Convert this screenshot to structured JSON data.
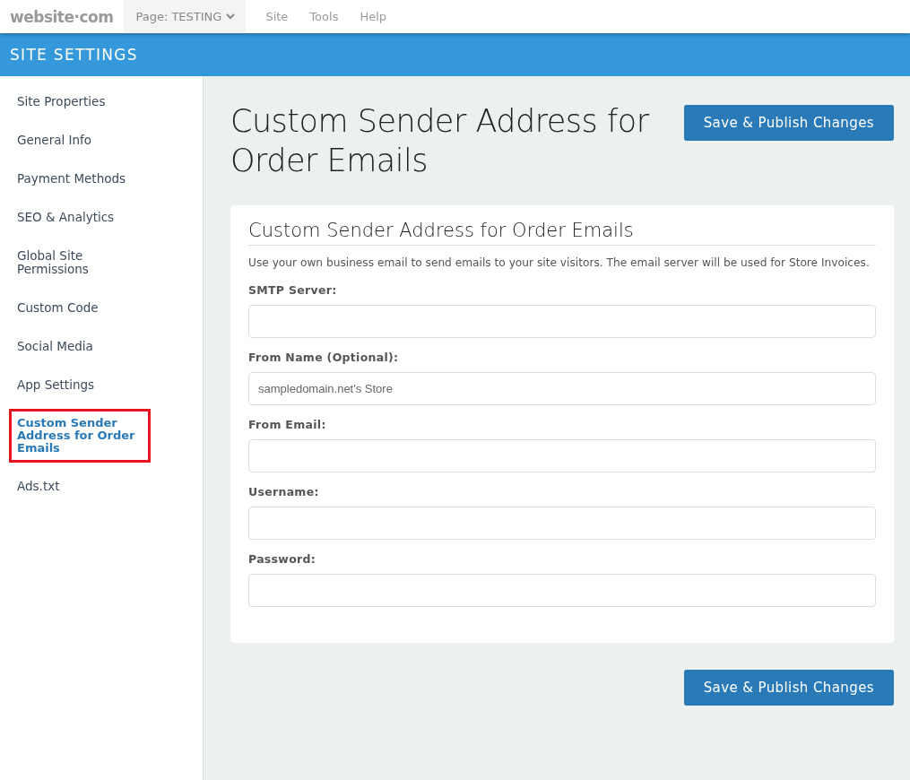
{
  "topbar": {
    "logo": "website·com",
    "page_menu": {
      "label": "Page:",
      "value": "TESTING"
    },
    "menu": [
      "Site",
      "Tools",
      "Help"
    ]
  },
  "header": {
    "title": "SITE SETTINGS"
  },
  "sidebar": {
    "items": [
      {
        "label": "Site Properties",
        "selected": false
      },
      {
        "label": "General Info",
        "selected": false
      },
      {
        "label": "Payment Methods",
        "selected": false
      },
      {
        "label": "SEO & Analytics",
        "selected": false
      },
      {
        "label": "Global Site Permissions",
        "selected": false
      },
      {
        "label": "Custom Code",
        "selected": false
      },
      {
        "label": "Social Media",
        "selected": false
      },
      {
        "label": "App Settings",
        "selected": false
      },
      {
        "label": "Custom Sender Address for Order Emails",
        "selected": true
      },
      {
        "label": "Ads.txt",
        "selected": false
      }
    ]
  },
  "main": {
    "title": "Custom Sender Address for Order Emails",
    "save_button": "Save & Publish Changes",
    "card": {
      "title": "Custom Sender Address for Order Emails",
      "description": "Use your own business email to send emails to your site visitors. The email server will be used for Store Invoices.",
      "fields": [
        {
          "label": "SMTP Server:"
        },
        {
          "label": "From Name (Optional):",
          "placeholder": "sampledomain.net's Store"
        },
        {
          "label": "From Email:"
        },
        {
          "label": "Username:"
        },
        {
          "label": "Password:"
        }
      ]
    },
    "bottom_button": "Save & Publish Changes"
  }
}
